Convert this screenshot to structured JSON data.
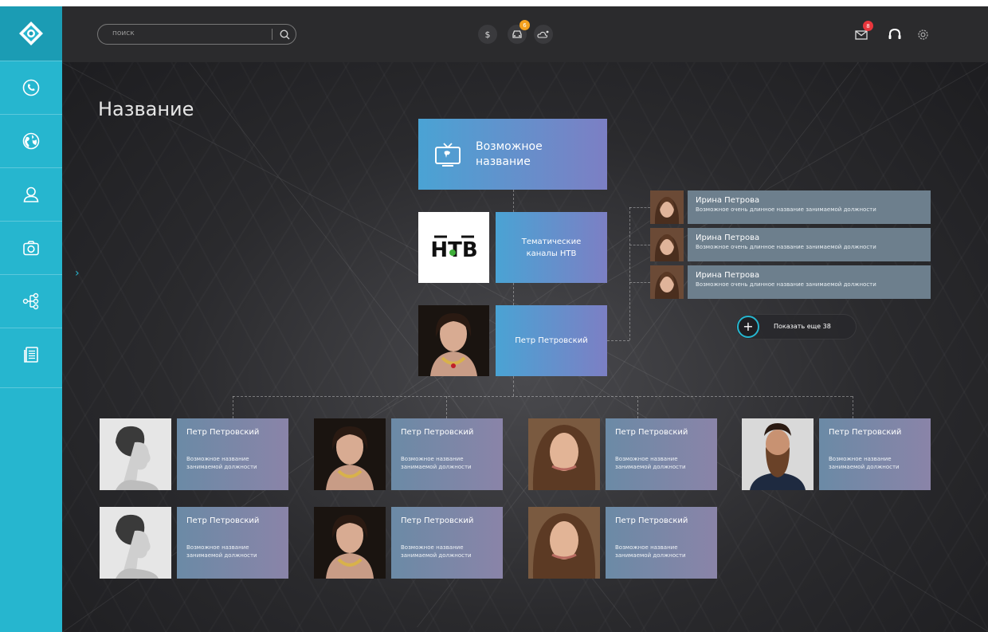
{
  "header": {
    "search_placeholder": "поиск",
    "icons": [
      "dollar-icon",
      "car-icon",
      "weather-icon",
      "mail-icon",
      "headset-icon",
      "gear-icon"
    ],
    "dollar_symbol": "$",
    "car_badge": "6",
    "mail_badge": "8",
    "badge_colors": {
      "car": "#f4a11e",
      "mail": "#e8363c"
    }
  },
  "sidebar": {
    "accent": "#26b6cf",
    "items": [
      "phone-icon",
      "globe-icon",
      "user-icon",
      "camera-icon",
      "hierarchy-icon",
      "document-icon"
    ]
  },
  "page": {
    "title": "Название"
  },
  "org": {
    "root_label": "Возможное название",
    "channel_label": "Тематические каналы НТВ",
    "channel_logo_text": "НТВ",
    "head_name": "Петр Петровский",
    "right_items": [
      {
        "name": "Ирина Петрова",
        "position": "Возможное очень длинное  название занимаемой должности"
      },
      {
        "name": "Ирина Петрова",
        "position": "Возможное очень длинное  название занимаемой должности"
      },
      {
        "name": "Ирина Петрова",
        "position": "Возможное очень длинное  название занимаемой должности"
      }
    ],
    "show_more_label": "Показать еще 38",
    "employees": [
      {
        "name": "Петр Петровский",
        "position": "Возможное название занимаемой должности"
      },
      {
        "name": "Петр Петровский",
        "position": "Возможное название занимаемой должности"
      },
      {
        "name": "Петр Петровский",
        "position": "Возможное название занимаемой должности"
      },
      {
        "name": "Петр Петровский",
        "position": "Возможное название занимаемой должности"
      },
      {
        "name": "Петр Петровский",
        "position": "Возможное название занимаемой должности"
      },
      {
        "name": "Петр Петровский",
        "position": "Возможное название занимаемой должности"
      },
      {
        "name": "Петр Петровский",
        "position": "Возможное название занимаемой должности"
      }
    ]
  }
}
